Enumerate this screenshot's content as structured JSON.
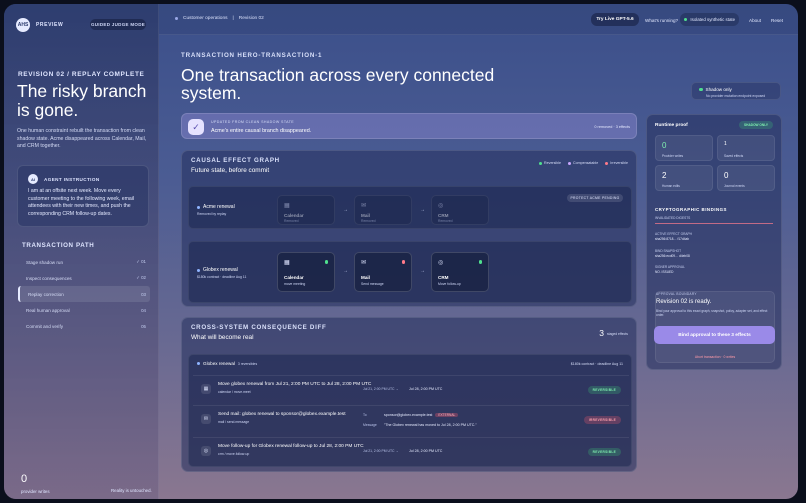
{
  "sidebar": {
    "logo": "AHS",
    "preview": "PREVIEW",
    "guided": "GUIDED JUDGE MODE",
    "revision": "REVISION 02 / REPLAY COMPLETE",
    "headline": "The risky branch is gone.",
    "description": "One human constraint rebuilt the transaction from clean shadow state. Acme disappeared across Calendar, Mail, and CRM together.",
    "agent_avatar": "AI",
    "agent_title": "AGENT INSTRUCTION",
    "agent_body": "I am at an offsite next week. Move every customer meeting to the following week, email attendees with their new times, and push the corresponding CRM follow-up dates.",
    "path_title": "TRANSACTION PATH",
    "steps": [
      {
        "label": "Stage shadow run",
        "num": "✓ 01"
      },
      {
        "label": "Inspect consequences",
        "num": "✓ 02"
      },
      {
        "label": "Replay correction",
        "num": "03"
      },
      {
        "label": "Real human approval",
        "num": "04"
      },
      {
        "label": "Commit and verify",
        "num": "05"
      }
    ],
    "provider_count": "0",
    "provider_label": "provider writes",
    "reality": "Reality is untouched."
  },
  "topbar": {
    "crumb1": "Customer operations",
    "crumb2": "Revision 02",
    "try_btn": "Try Live GPT-5.6",
    "whats": "What's running?",
    "isolated": "Isolated synthetic state",
    "about": "About",
    "reset": "Reset"
  },
  "hero": {
    "tag": "TRANSACTION HERO-TRANSACTION-1",
    "title": "One transaction across every connected system.",
    "shadow_title": "Shadow only",
    "shadow_sub": "No provider mutation endpoint exposed"
  },
  "banner": {
    "kicker": "UPDATED FROM CLEAN SHADOW STATE",
    "text": "Acme's entire causal branch disappeared.",
    "right": "0 removed · 3 effects"
  },
  "graph": {
    "heading": "CAUSAL EFFECT GRAPH",
    "sub": "Future state, before commit",
    "legend": [
      "Reversible",
      "Compensatable",
      "Irreversible"
    ],
    "protect": "PROTECT ACME PENDING",
    "rows": [
      {
        "name": "Acme renewal",
        "sub": "Removed by replay",
        "nodes": [
          {
            "label": "Calendar",
            "sub": "Removed"
          },
          {
            "label": "Mail",
            "sub": "Removed"
          },
          {
            "label": "CRM",
            "sub": "Removed"
          }
        ]
      },
      {
        "name": "Globex renewal",
        "sub": "$180k contract · deadline Aug 11",
        "nodes": [
          {
            "label": "Calendar",
            "sub": "move meeting"
          },
          {
            "label": "Mail",
            "sub": "Send message"
          },
          {
            "label": "CRM",
            "sub": "Move follow-up"
          }
        ]
      }
    ]
  },
  "diff": {
    "heading": "CROSS-SYSTEM CONSEQUENCE DIFF",
    "sub": "What will become real",
    "count": "3",
    "count_label": "staged effects",
    "group": "Globex renewal",
    "group_meta": "3 reversibles",
    "group_right": "$180k contract · deadline Aug 11",
    "effects": [
      {
        "title": "Move globex renewal from Jul 21, 2:00 PM UTC to Jul 28, 2:00 PM UTC",
        "sub": "calendar / move.meet",
        "k1": "Jul 21, 2:00 PM UTC → ",
        "v1": "Jul 28, 2:00 PM UTC",
        "badge": "REVERSIBLE"
      },
      {
        "title": "Send mail: globex renewal to sponsor@globex.example.test",
        "sub": "mail / send.message",
        "k1": "To",
        "v1": "sponsor@globex.example.test",
        "ext": "EXTERNAL",
        "k2": "Message",
        "v2": "\"The Globex renewal has moved to Jul 28, 2:00 PM UTC.\"",
        "badge": "IRREVERSIBLE"
      },
      {
        "title": "Move follow-up for Globex renewal follow-up to Jul 28, 2:00 PM UTC",
        "sub": "crm / move.follow-up",
        "k1": "Jul 21, 2:00 PM UTC → ",
        "v1": "Jul 28, 2:00 PM UTC",
        "badge": "REVERSIBLE"
      }
    ]
  },
  "proof": {
    "title": "Runtime proof",
    "badge": "SHADOW ONLY",
    "stats": [
      {
        "n": "0",
        "l": "Provider writes"
      },
      {
        "n": "1",
        "l": "Saved effects"
      },
      {
        "n": "2",
        "l": "Human edits"
      },
      {
        "n": "0",
        "l": "Journal events"
      }
    ],
    "crypto": "CRYPTOGRAPHIC BINDINGS",
    "bindings": [
      {
        "k": "INVALIDATED DIGESTS",
        "v": ""
      },
      {
        "k": "ACTIVE EFFECT GRAPH",
        "v": "sha256:8718… f17d4ab"
      },
      {
        "k": "BIND SNAPSHOT",
        "v": "sha256:ecd09… d4eb08"
      },
      {
        "k": "SIGNER APPROVAL",
        "v": "NO. ISSUED"
      }
    ],
    "approve_kicker": "APPROVAL BOUNDARY",
    "approve_title": "Revision 02 is ready.",
    "approve_desc": "Bind your approval to this exact graph, snapshot, policy, adapter set, and effect order.",
    "approve_btn": "Bind approval to these 3 effects",
    "abort": "Abort transaction · 0 writes"
  }
}
